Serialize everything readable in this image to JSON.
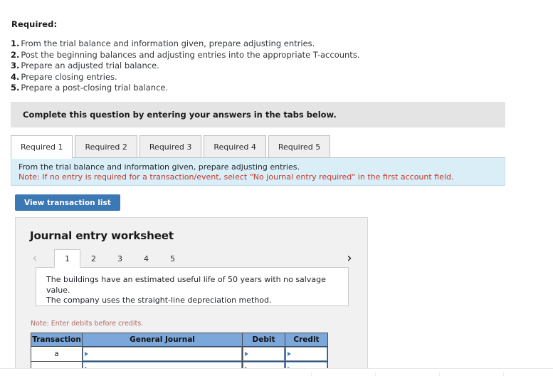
{
  "required": {
    "heading": "Required:",
    "items": [
      {
        "num": "1.",
        "text": "From the trial balance and information given, prepare adjusting entries."
      },
      {
        "num": "2.",
        "text": "Post the beginning balances and adjusting entries into the appropriate T-accounts."
      },
      {
        "num": "3.",
        "text": "Prepare an adjusted trial balance."
      },
      {
        "num": "4.",
        "text": "Prepare closing entries."
      },
      {
        "num": "5.",
        "text": "Prepare a post-closing trial balance."
      }
    ]
  },
  "banner": {
    "text": "Complete this question by entering your answers in the tabs below."
  },
  "tabs": {
    "items": [
      {
        "label": "Required 1",
        "active": true
      },
      {
        "label": "Required 2",
        "active": false
      },
      {
        "label": "Required 3",
        "active": false
      },
      {
        "label": "Required 4",
        "active": false
      },
      {
        "label": "Required 5",
        "active": false
      }
    ]
  },
  "info": {
    "line1": "From the trial balance and information given, prepare adjusting entries.",
    "line2": "Note: If no entry is required for a transaction/event, select \"No journal entry required\" in the first account field."
  },
  "buttons": {
    "view_transaction_list": "View transaction list"
  },
  "worksheet": {
    "title": "Journal entry worksheet",
    "prev_icon": "chevron-left",
    "next_icon": "chevron-right",
    "entry_tabs": [
      {
        "label": "1",
        "active": true
      },
      {
        "label": "2",
        "active": false
      },
      {
        "label": "3",
        "active": false
      },
      {
        "label": "4",
        "active": false
      },
      {
        "label": "5",
        "active": false
      }
    ],
    "description_lines": [
      "The buildings have an estimated useful life of 50 years with no salvage value.",
      "The company uses the straight-line depreciation method."
    ],
    "note": "Note: Enter debits before credits.",
    "table": {
      "headers": [
        "Transaction",
        "General Journal",
        "Debit",
        "Credit"
      ],
      "rows": [
        {
          "transaction": "a",
          "general_journal": "",
          "debit": "",
          "credit": ""
        },
        {
          "transaction": "",
          "general_journal": "",
          "debit": "",
          "credit": ""
        }
      ]
    }
  },
  "colors": {
    "banner_gray": "#e4e4e4",
    "info_blue": "#daeef8",
    "note_red": "#c0392b",
    "button_blue": "#3c78b4",
    "table_header_blue": "#7ba7db",
    "input_border_blue": "#5b8fc9"
  }
}
